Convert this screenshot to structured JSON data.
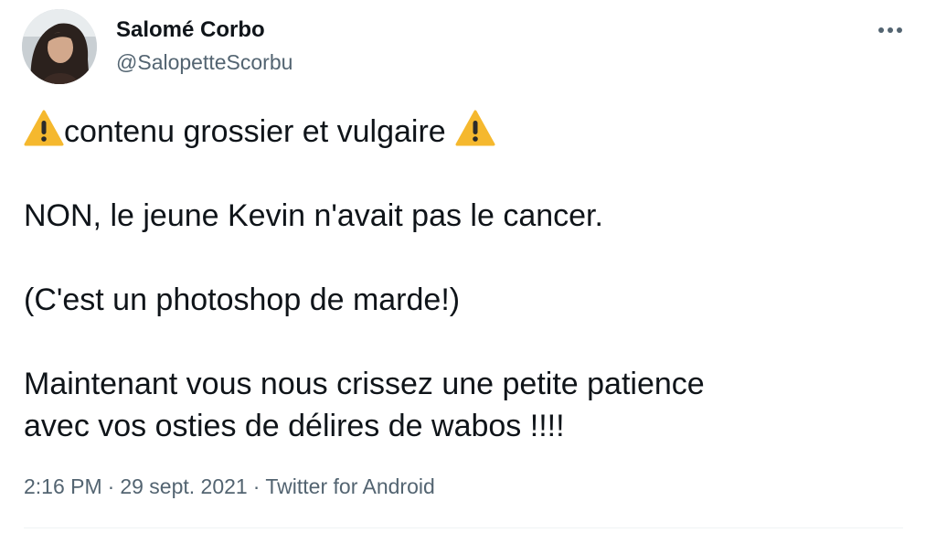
{
  "author": {
    "name": "Salomé Corbo",
    "handle": "@SalopetteScorbu"
  },
  "menu": {
    "icon": "more-dots-icon"
  },
  "tweet": {
    "warning_icon": "warning-emoji-icon",
    "line1_text": "contenu grossier et vulgaire",
    "line2": "NON, le jeune Kevin n'avait pas le cancer.",
    "line3": "(C'est un photoshop de marde!)",
    "line4a": "Maintenant vous nous crissez une petite patience",
    "line4b": "avec vos osties de délires de wabos !!!!"
  },
  "meta": {
    "time": "2:16 PM",
    "separator": "·",
    "date": "29 sept. 2021",
    "source": "Twitter for Android"
  },
  "colors": {
    "text": "#0f1419",
    "secondary": "#536471",
    "divider": "#eff3f4",
    "warning": "#f5b82e"
  }
}
